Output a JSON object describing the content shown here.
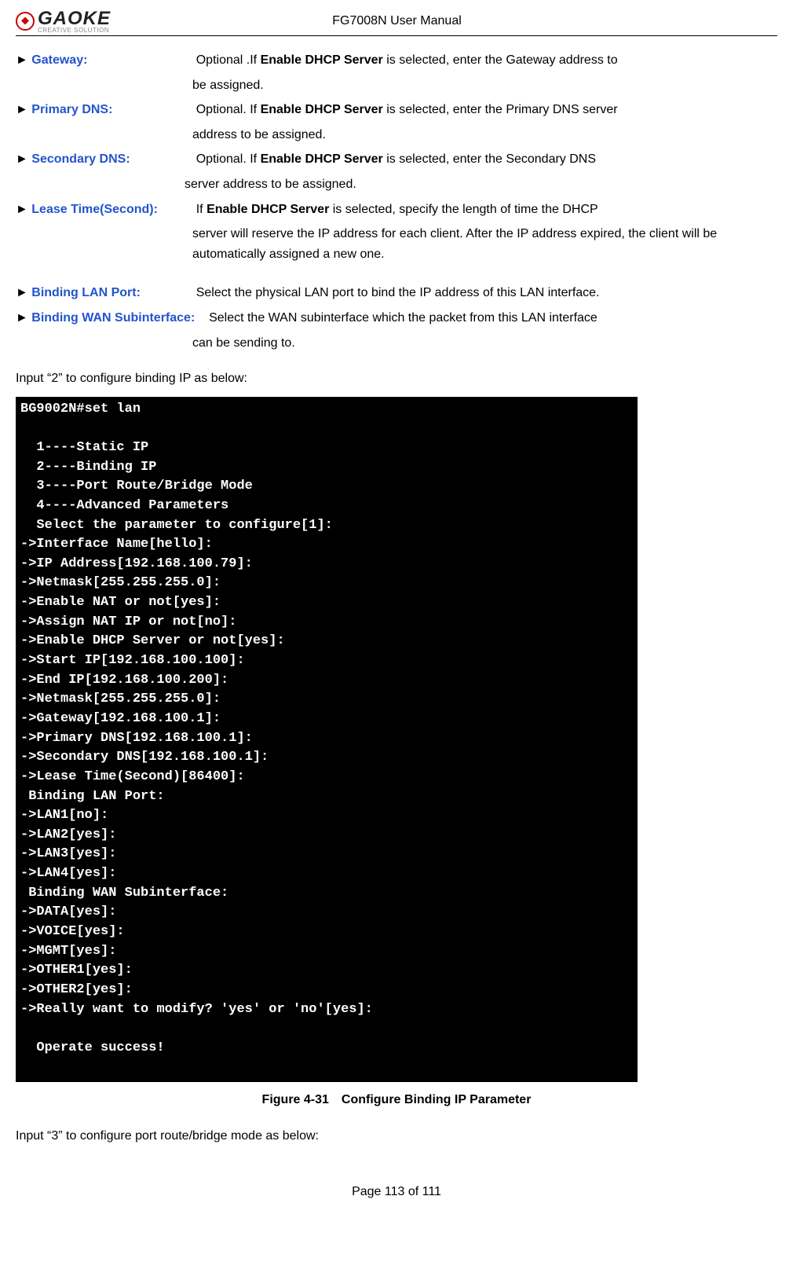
{
  "header": {
    "logo_text": "GAOKE",
    "logo_sub": "CREATIVE SOLUTION",
    "manual_title": "FG7008N User Manual"
  },
  "definitions": [
    {
      "term": "Gateway:",
      "desc_prefix": "Optional .If ",
      "desc_bold": "Enable DHCP Server",
      "desc_suffix": " is selected, enter the Gateway address to",
      "cont": "be assigned."
    },
    {
      "term": "Primary DNS:",
      "desc_prefix": "Optional. If ",
      "desc_bold": "Enable DHCP Server",
      "desc_suffix": " is selected, enter the Primary DNS server",
      "cont": "address to be assigned."
    },
    {
      "term": "Secondary DNS:",
      "desc_prefix": "Optional. If ",
      "desc_bold": "Enable DHCP Server",
      "desc_suffix": " is selected, enter the Secondary DNS",
      "cont": "server address to be assigned."
    },
    {
      "term": "Lease Time(Second):",
      "desc_prefix": "If ",
      "desc_bold": "Enable DHCP Server",
      "desc_suffix": " is selected, specify the length of time the DHCP",
      "cont": "server will reserve the IP address for each client. After the IP address expired, the client will be automatically assigned a new one."
    }
  ],
  "definitions2": [
    {
      "term": "Binding LAN Port:",
      "desc": "Select the physical LAN port to bind the IP address of this LAN interface."
    },
    {
      "term": "Binding WAN Subinterface:",
      "desc": "Select the WAN subinterface which the packet from this LAN interface",
      "cont": "can be sending to.",
      "inline": true
    }
  ],
  "intro_line": "Input “2” to configure binding IP as below:",
  "terminal_lines": [
    "BG9002N#set lan",
    "",
    "  1----Static IP",
    "  2----Binding IP",
    "  3----Port Route/Bridge Mode",
    "  4----Advanced Parameters",
    "  Select the parameter to configure[1]:",
    "->Interface Name[hello]:",
    "->IP Address[192.168.100.79]:",
    "->Netmask[255.255.255.0]:",
    "->Enable NAT or not[yes]:",
    "->Assign NAT IP or not[no]:",
    "->Enable DHCP Server or not[yes]:",
    "->Start IP[192.168.100.100]:",
    "->End IP[192.168.100.200]:",
    "->Netmask[255.255.255.0]:",
    "->Gateway[192.168.100.1]:",
    "->Primary DNS[192.168.100.1]:",
    "->Secondary DNS[192.168.100.1]:",
    "->Lease Time(Second)[86400]:",
    " Binding LAN Port:",
    "->LAN1[no]:",
    "->LAN2[yes]:",
    "->LAN3[yes]:",
    "->LAN4[yes]:",
    " Binding WAN Subinterface:",
    "->DATA[yes]:",
    "->VOICE[yes]:",
    "->MGMT[yes]:",
    "->OTHER1[yes]:",
    "->OTHER2[yes]:",
    "->Really want to modify? 'yes' or 'no'[yes]:",
    "",
    "  Operate success!"
  ],
  "figure_caption": "Figure 4-31 Configure Binding IP Parameter",
  "outro_line": "Input “3” to configure port route/bridge mode as below:",
  "footer_text": "Page 113 of 111"
}
